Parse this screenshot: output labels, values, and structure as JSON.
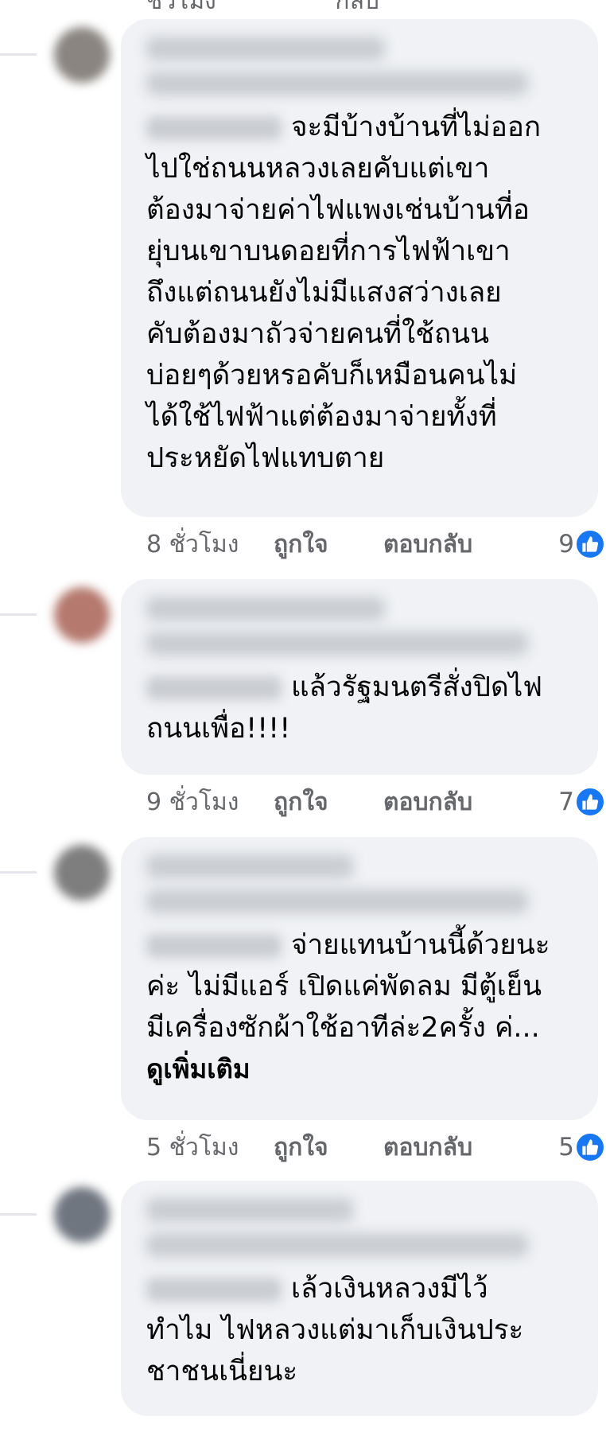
{
  "top_partial": {
    "time": "ชั่วโมง",
    "reply": "กลับ"
  },
  "comments": [
    {
      "text": "จะมีบ้างบ้านที่ไม่ออก\nไปใช่ถนนหลวงเลยคับแต่เขา\nต้องมาจ่ายค่าไฟแพงเช่นบ้านที่อ\nยุ่บนเขาบนดอยที่การไฟฟ้าเขา\nถึงแต่ถนนยังไม่มีแสงสว่างเลย\nคับต้องมาถัวจ่ายคนที่ใช้ถนน\nบ่อยๆด้วยหรอคับก็เหมือนคนไม่\nได้ใช้ไฟฟ้าแต่ต้องมาจ่ายทั้งที่\nประหยัดไฟแทบตาย",
      "time": "8 ชั่วโมง",
      "like": "ถูกใจ",
      "reply": "ตอบกลับ",
      "reactions": "9"
    },
    {
      "text": "แล้วรัฐมนตรีสั่งปิดไฟ\nถนนเพื่อ!!!!",
      "time": "9 ชั่วโมง",
      "like": "ถูกใจ",
      "reply": "ตอบกลับ",
      "reactions": "7"
    },
    {
      "text": "จ่ายแทนบ้านนี้ด้วยนะ\nค่ะ ไม่มีแอร์ เปิดแค่พัดลม มีตู้เย็น\nมีเครื่องซักผ้าใช้อาทีล่ะ2ครั้ง ค่...",
      "see_more": "ดูเพิ่มเติม",
      "time": "5 ชั่วโมง",
      "like": "ถูกใจ",
      "reply": "ตอบกลับ",
      "reactions": "5"
    },
    {
      "text": "เล้วเงินหลวงมีไว้\nทำไม ไฟหลวงแต่มาเก็บเงินประ\nชาชนเนี่ยนะ"
    }
  ],
  "colors": {
    "bubble": "#f0f2f5",
    "meta": "#65676b",
    "like_badge": "#1877f2"
  },
  "icons": {
    "reaction": "like-thumb-icon"
  }
}
